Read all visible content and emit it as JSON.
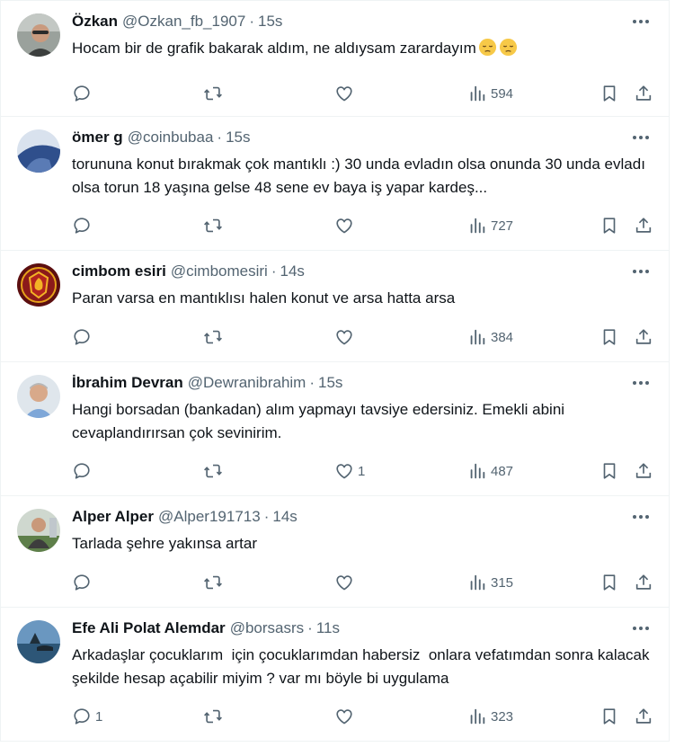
{
  "tweets": [
    {
      "name": "Özkan",
      "handle": "@Ozkan_fb_1907",
      "time": "15s",
      "text": "Hocam bir de grafik bakarak aldım, ne aldıysam zarardayım",
      "emoji": "pensive-face-emoji",
      "replies": "",
      "retweets": "",
      "likes": "",
      "views": "594",
      "avatar_color": "#8a8f8c"
    },
    {
      "name": "ömer g",
      "handle": "@coinbubaa",
      "time": "15s",
      "text": "torununa konut bırakmak çok mantıklı :) 30 unda evladın olsa onunda 30 unda evladı olsa torun 18 yaşına gelse 48 sene ev baya iş yapar kardeş...",
      "replies": "",
      "retweets": "",
      "likes": "",
      "views": "727",
      "avatar_color": "#3a5fa0"
    },
    {
      "name": "cimbom esiri",
      "handle": "@cimbomesiri",
      "time": "14s",
      "text": "Paran varsa en mantıklısı halen konut ve arsa hatta arsa",
      "replies": "",
      "retweets": "",
      "likes": "",
      "views": "384",
      "avatar_color": "#8b1a1a"
    },
    {
      "name": "İbrahim Devran",
      "handle": "@Dewranibrahim",
      "time": "15s",
      "text": "Hangi borsadan (bankadan) alım yapmayı tavsiye edersiniz. Emekli abini cevaplandırırsan çok sevinirim.",
      "replies": "",
      "retweets": "",
      "likes": "1",
      "views": "487",
      "avatar_color": "#c9d3dc"
    },
    {
      "name": "Alper Alper",
      "handle": "@Alper191713",
      "time": "14s",
      "text": "Tarlada şehre yakınsa artar",
      "replies": "",
      "retweets": "",
      "likes": "",
      "views": "315",
      "avatar_color": "#6d8d5a"
    },
    {
      "name": "Efe Ali Polat Alemdar",
      "handle": "@borsasrs",
      "time": "11s",
      "text": "Arkadaşlar çocuklarım  için çocuklarımdan habersiz  onlara vefatımdan sonra kalacak şekilde hesap açabilir miyim ? var mı böyle bi uygulama",
      "replies": "1",
      "retweets": "",
      "likes": "",
      "views": "323",
      "avatar_color": "#3d6f9a"
    }
  ],
  "icons": {
    "reply": "reply-icon",
    "retweet": "retweet-icon",
    "like": "like-icon",
    "views": "views-icon",
    "bookmark": "bookmark-icon",
    "share": "share-icon",
    "more": "more-icon"
  },
  "colors": {
    "text_primary": "#0f1419",
    "text_secondary": "#536471",
    "border": "#eff3f4"
  }
}
